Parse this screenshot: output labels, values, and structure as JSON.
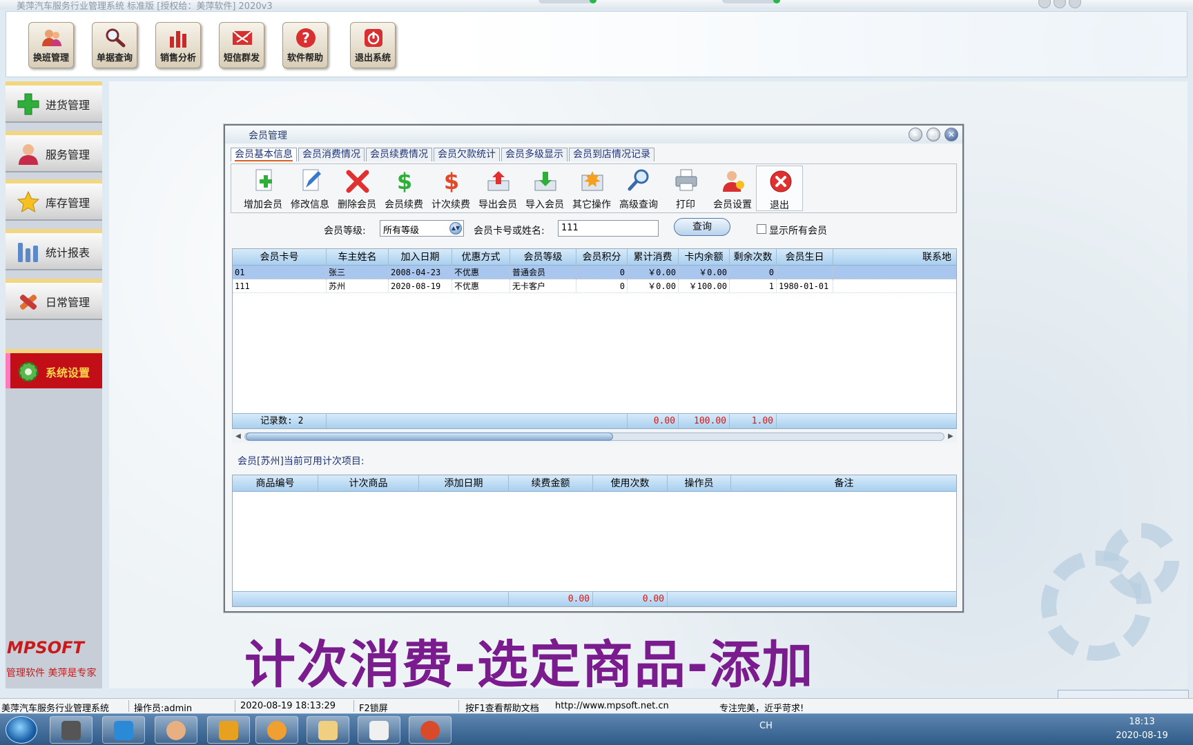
{
  "window": {
    "title": "美萍汽车服务行业管理系统 标准版 [授权给：美萍软件] 2020v3"
  },
  "toolbar": {
    "items": [
      {
        "label": "换班管理",
        "icon": "users-icon"
      },
      {
        "label": "单据查询",
        "icon": "magnifier-icon"
      },
      {
        "label": "销售分析",
        "icon": "bar-chart-icon"
      },
      {
        "label": "短信群发",
        "icon": "envelope-icon"
      },
      {
        "label": "软件帮助",
        "icon": "help-icon"
      },
      {
        "label": "退出系统",
        "icon": "power-icon"
      }
    ]
  },
  "sidebar": {
    "items": [
      {
        "label": "进货管理",
        "icon": "plus-icon"
      },
      {
        "label": "服务管理",
        "icon": "person-icon"
      },
      {
        "label": "库存管理",
        "icon": "star-icon"
      },
      {
        "label": "统计报表",
        "icon": "bars-icon"
      },
      {
        "label": "日常管理",
        "icon": "tools-icon"
      },
      {
        "label": "系统设置",
        "icon": "gear-icon",
        "active": true
      }
    ],
    "logo": "MPSOFT",
    "slogan": "管理软件  美萍是专家"
  },
  "dialog": {
    "title": "会员管理",
    "tabs": [
      "会员基本信息",
      "会员消费情况",
      "会员续费情况",
      "会员欠款统计",
      "会员多级显示",
      "会员到店情况记录"
    ],
    "active_tab": "会员基本信息",
    "toolbar": [
      {
        "label": "增加会员",
        "icon": "add-member-icon"
      },
      {
        "label": "修改信息",
        "icon": "edit-document-icon"
      },
      {
        "label": "删除会员",
        "icon": "delete-x-icon"
      },
      {
        "label": "会员续费",
        "icon": "dollar-icon"
      },
      {
        "label": "计次续费",
        "icon": "dollar-count-icon"
      },
      {
        "label": "导出会员",
        "icon": "export-icon"
      },
      {
        "label": "导入会员",
        "icon": "import-icon"
      },
      {
        "label": "其它操作",
        "icon": "burst-icon"
      },
      {
        "label": "高级查询",
        "icon": "magnifier-icon"
      },
      {
        "label": "打印",
        "icon": "printer-icon"
      },
      {
        "label": "会员设置",
        "icon": "member-settings-icon"
      },
      {
        "label": "退出",
        "icon": "close-red-icon"
      }
    ],
    "filter": {
      "level_label": "会员等级:",
      "level_value": "所有等级",
      "search_label": "会员卡号或姓名:",
      "search_value": "111",
      "query_button": "查询",
      "show_all_label": "显示所有会员",
      "show_all_checked": false
    },
    "members_table": {
      "columns": [
        "会员卡号",
        "车主姓名",
        "加入日期",
        "优惠方式",
        "会员等级",
        "会员积分",
        "累计消费",
        "卡内余额",
        "剩余次数",
        "会员生日",
        "联系地"
      ],
      "rows": [
        [
          "01",
          "张三",
          "2008-04-23",
          "不优惠",
          "普通会员",
          "0",
          "￥0.00",
          "￥0.00",
          "0",
          ""
        ],
        [
          "111",
          "苏州",
          "2020-08-19",
          "不优惠",
          "无卡客户",
          "0",
          "￥0.00",
          "￥100.00",
          "1",
          "1980-01-01"
        ]
      ],
      "selected_row": 0,
      "footer": {
        "record_count_label": "记录数: 2",
        "total_consumption": "0.00",
        "total_balance": "100.00",
        "total_remaining": "1.00"
      }
    },
    "items_caption": "会员[苏州]当前可用计次项目:",
    "items_table": {
      "columns": [
        "商品编号",
        "计次商品",
        "添加日期",
        "续费金额",
        "使用次数",
        "操作员",
        "备注"
      ],
      "rows": [],
      "footer": {
        "total_amount": "0.00",
        "total_count": "0.00"
      }
    }
  },
  "caption": "计次消费-选定商品-添加",
  "statusbar": {
    "app": "美萍汽车服务行业管理系统",
    "operator": "操作员:admin",
    "datetime": "2020-08-19 18:13:29",
    "lock": "F2锁屏",
    "help": "按F1查看帮助文档",
    "url": "http://www.mpsoft.net.cn",
    "motto": "专注完美，近乎苛求!"
  },
  "taskbar": {
    "tray_lang": "CH",
    "time": "18:13",
    "date": "2020-08-19"
  },
  "colors": {
    "accent": "#1f3478",
    "selected_row": "#a8c6ee",
    "total_red": "#d01818",
    "caption": "#7a1b8e",
    "nav_active": "#c10e17"
  }
}
